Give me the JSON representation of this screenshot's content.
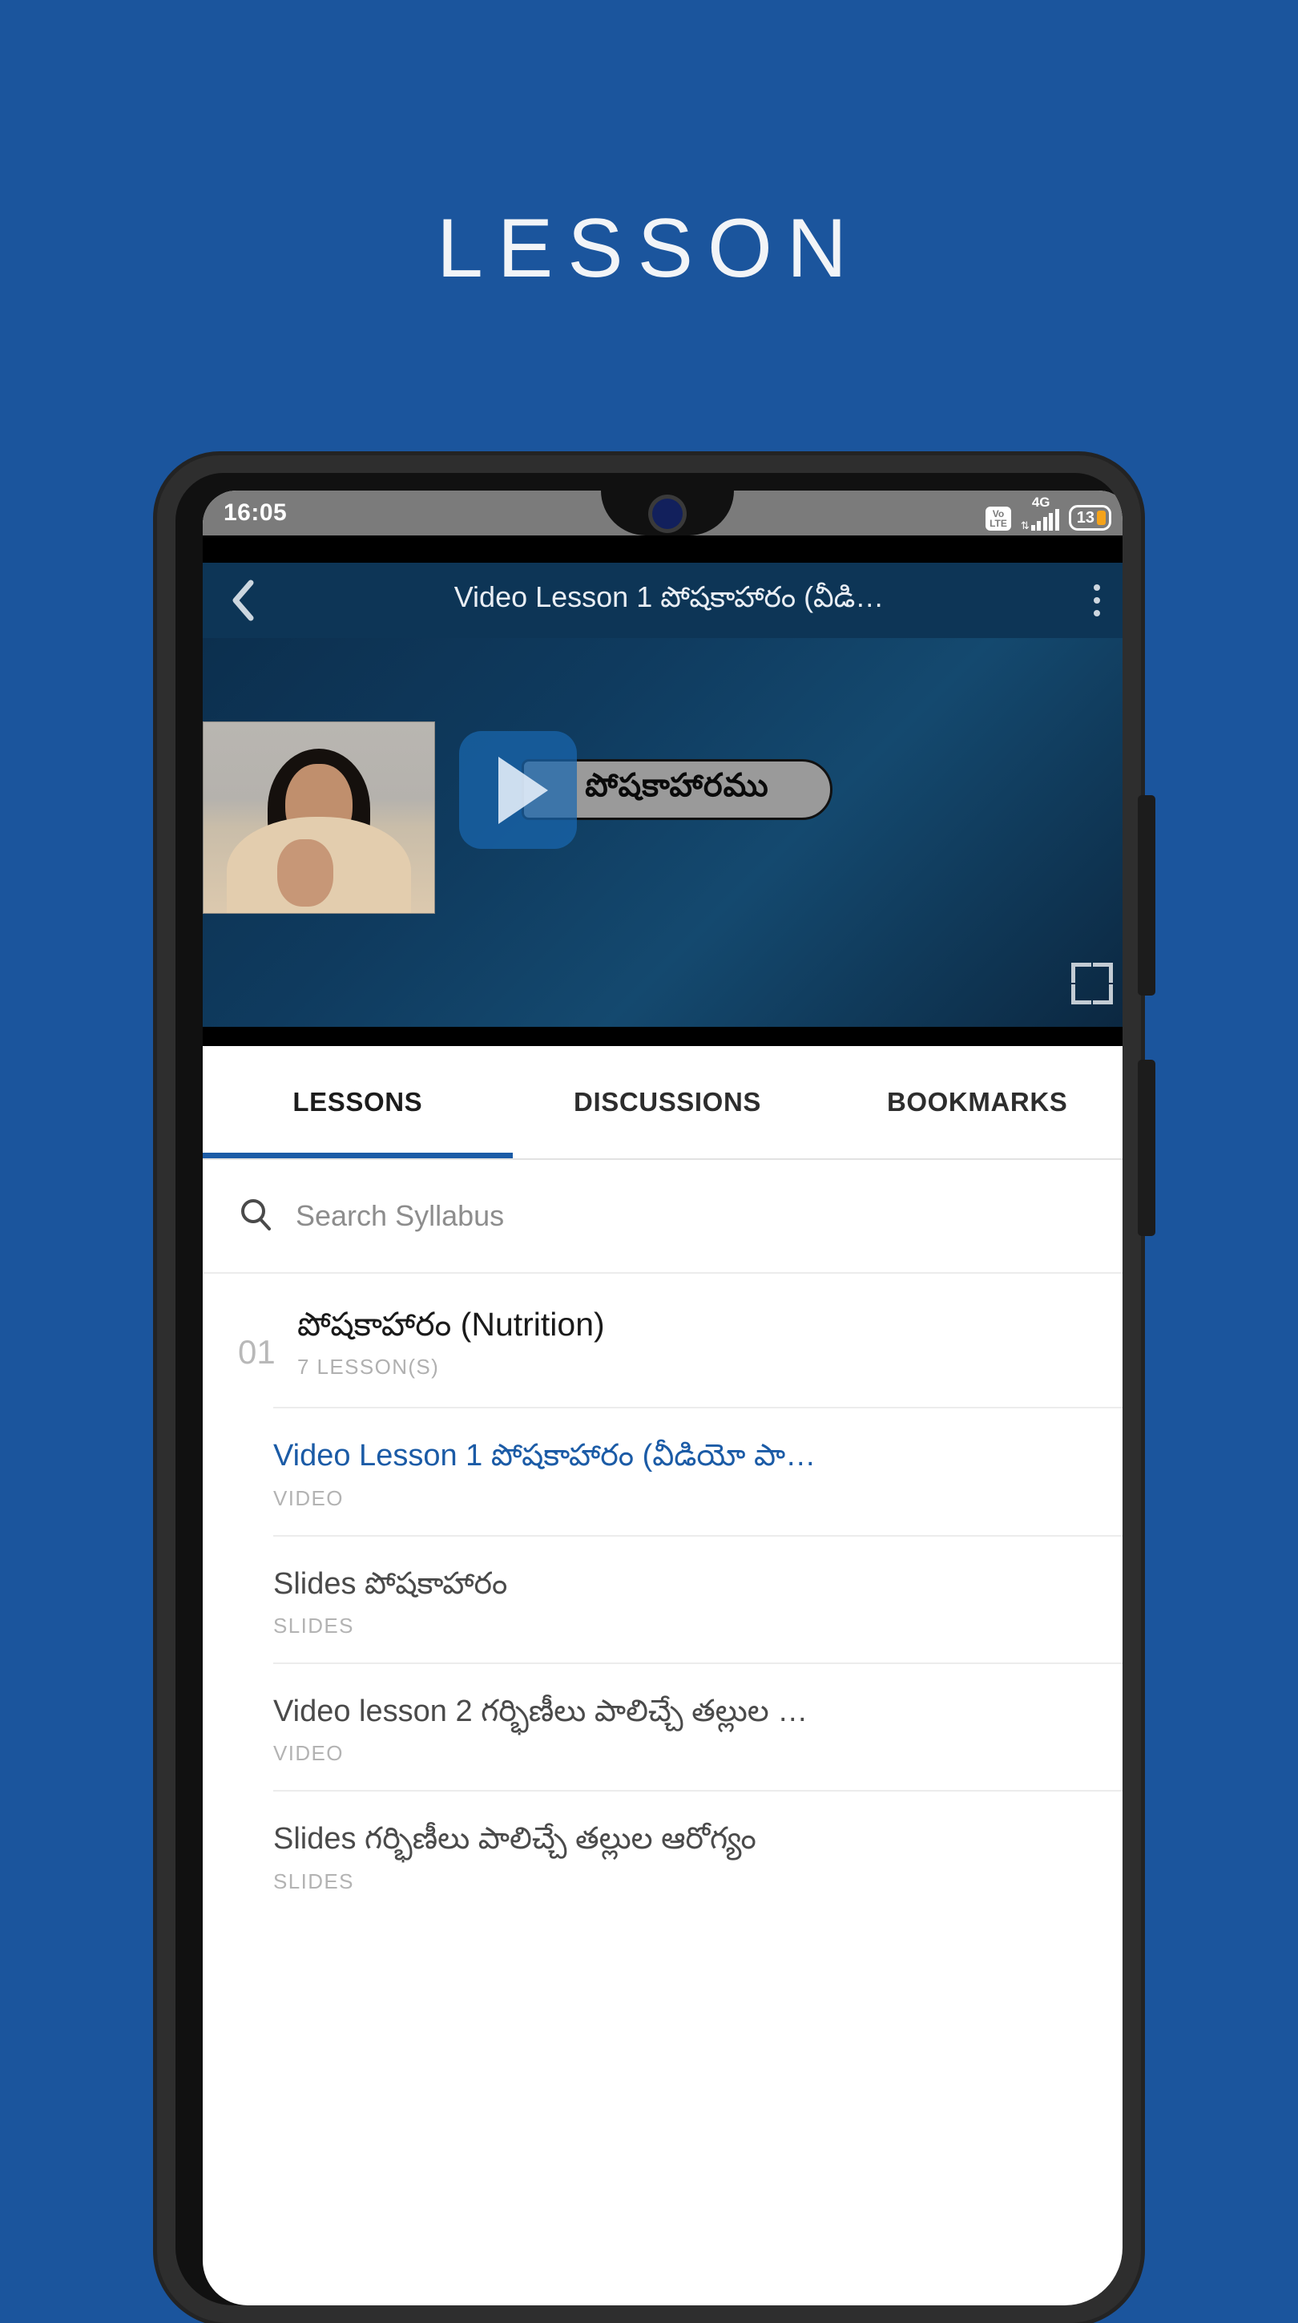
{
  "page": {
    "heading": "LESSON",
    "background_color": "#1b559d"
  },
  "status_bar": {
    "time": "16:05",
    "volte_top": "Vo",
    "volte_bottom": "LTE",
    "network": "4G",
    "data_arrows": "⇅",
    "battery_level": "13"
  },
  "app_bar": {
    "back_icon": "chevron-left-icon",
    "title": "Video Lesson 1 పోషకాహారం (వీడి…",
    "overflow_icon": "more-vertical-icon",
    "background_color": "#0d3556"
  },
  "player": {
    "play_icon": "play-icon",
    "caption_text": "పోషకాహారము",
    "fullscreen_icon": "fullscreen-icon",
    "accent_color": "#1966af"
  },
  "tabs": {
    "active_index": 0,
    "items": [
      {
        "label": "LESSONS"
      },
      {
        "label": "DISCUSSIONS"
      },
      {
        "label": "BOOKMARKS"
      }
    ],
    "indicator_color": "#1b5ba6"
  },
  "search": {
    "icon": "search-icon",
    "placeholder": "Search Syllabus",
    "value": ""
  },
  "syllabus": {
    "section": {
      "number": "01",
      "title": "పోషకాహారం (Nutrition)",
      "lesson_count_label": "7 LESSON(S)"
    },
    "lessons": [
      {
        "title": "Video Lesson 1 పోషకాహారం (వీడియో పా…",
        "type": "VIDEO",
        "active": true
      },
      {
        "title": "Slides పోషకాహారం",
        "type": "SLIDES",
        "active": false
      },
      {
        "title": "Video lesson 2 గర్భిణీలు పాలిచ్చే తల్లుల …",
        "type": "VIDEO",
        "active": false
      },
      {
        "title": "Slides గర్భిణీలు పాలిచ్చే తల్లుల ఆరోగ్యం",
        "type": "SLIDES",
        "active": false
      }
    ]
  }
}
